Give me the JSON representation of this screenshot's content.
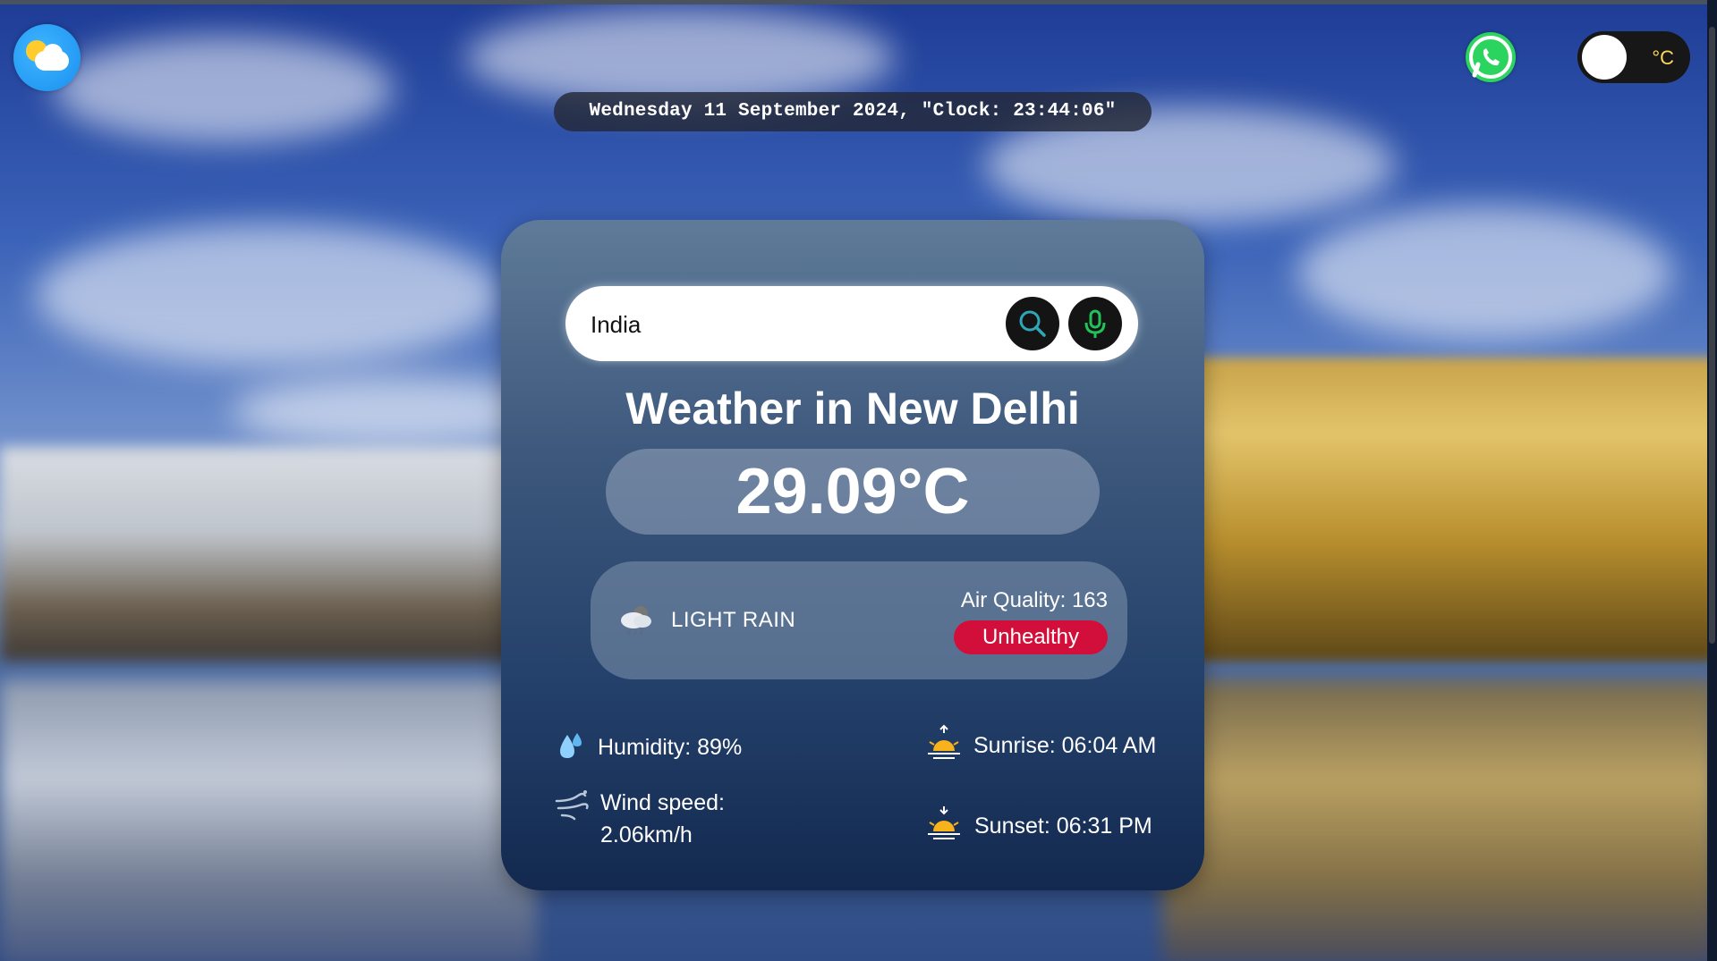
{
  "header": {
    "logo_icon": "sun-cloud-icon",
    "whatsapp_icon": "whatsapp-icon",
    "unit_toggle": {
      "unit_label": "°C"
    }
  },
  "datetime": "Wednesday 11 September 2024, \"Clock: 23:44:06\"",
  "search": {
    "value": "India",
    "search_icon": "search-icon",
    "mic_icon": "mic-icon"
  },
  "weather": {
    "title": "Weather in New Delhi",
    "temperature": "29.09°C",
    "condition": "LIGHT RAIN",
    "condition_icon": "rain-cloud-icon",
    "air_quality": "Air Quality: 163",
    "air_quality_status": "Unhealthy"
  },
  "stats": {
    "humidity": "Humidity: 89%",
    "wind_line1": "Wind speed:",
    "wind_line2": "2.06km/h",
    "sunrise": "Sunrise: 06:04 AM",
    "sunset": "Sunset: 06:31 PM"
  },
  "colors": {
    "aq_badge": "#d20f3b",
    "whatsapp": "#2bd35f",
    "card_top": "#5f7b99",
    "card_bottom": "#13294f"
  }
}
